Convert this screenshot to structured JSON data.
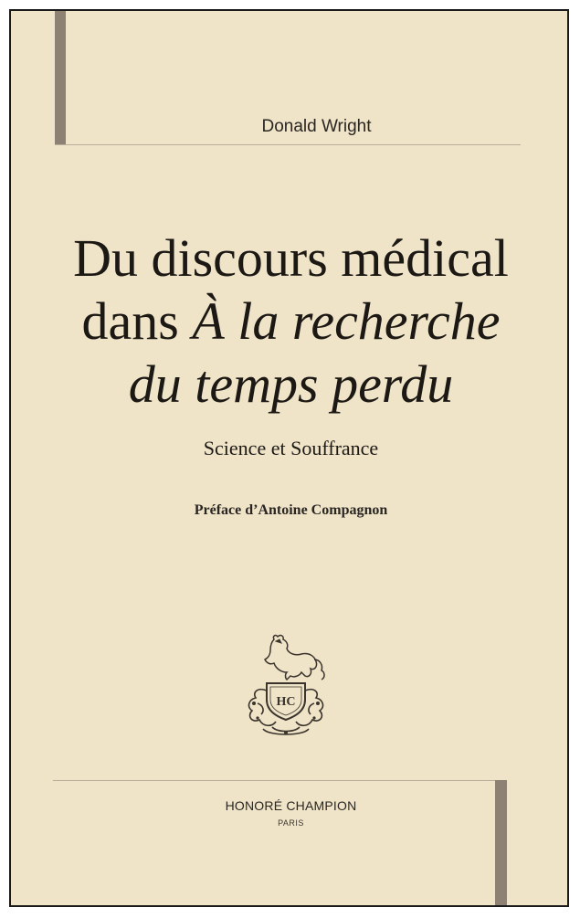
{
  "cover": {
    "author": "Donald Wright",
    "title": {
      "line1": "Du discours médical",
      "line2_roman": "dans ",
      "line2_italic": "À la recherche",
      "line3_italic": "du temps perdu"
    },
    "subtitle": "Science et Souffrance",
    "preface": "Préface d’Antoine Compagnon",
    "emblem": {
      "icon": "horse-emblem-icon",
      "monogram": "HC"
    },
    "publisher": "HONORÉ CHAMPION",
    "city": "PARIS"
  },
  "colors": {
    "background": "#efe3c8",
    "accent_bar": "#8c8173",
    "text": "#1c1915"
  }
}
